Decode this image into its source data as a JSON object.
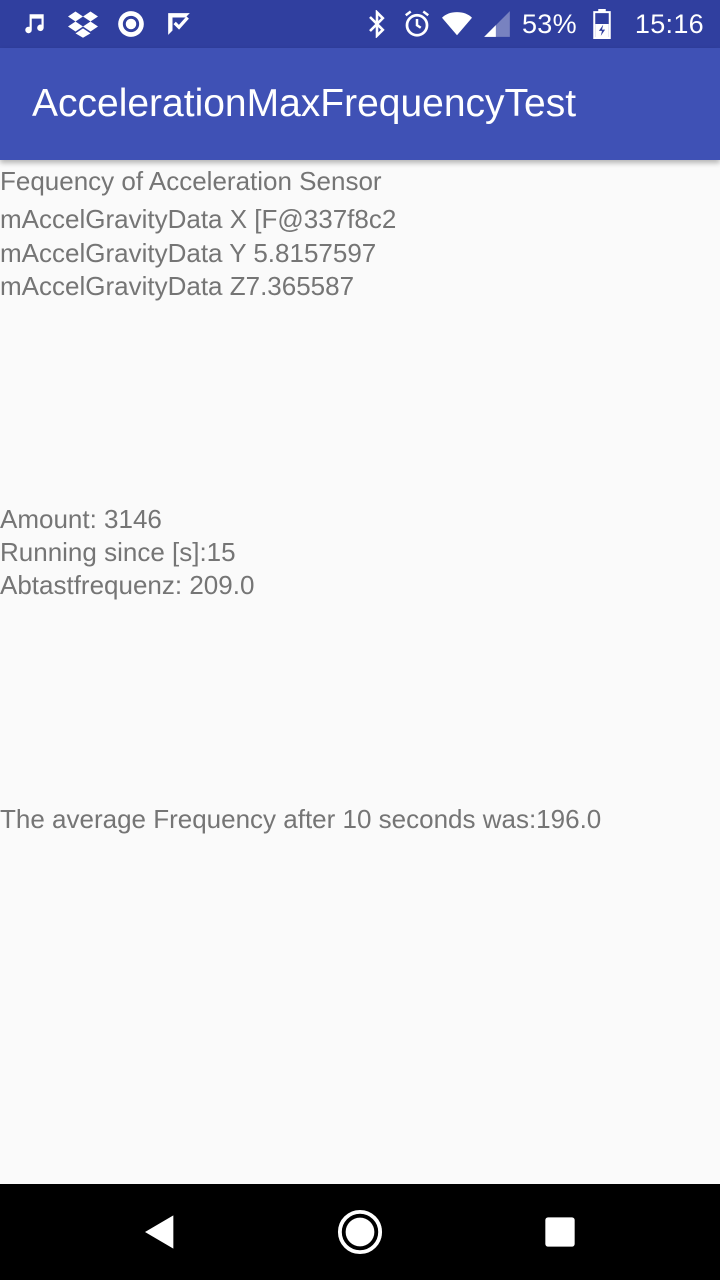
{
  "status_bar": {
    "icons_left": [
      "music-note-icon",
      "dropbox-icon",
      "record-circle-icon",
      "check-badge-icon"
    ],
    "icons_right": [
      "bluetooth-icon",
      "alarm-icon",
      "wifi-icon",
      "cell-signal-icon",
      "battery-icon"
    ],
    "battery_percent": "53%",
    "time": "15:16",
    "color": "#303f9f"
  },
  "app_bar": {
    "title": "AccelerationMaxFrequencyTest",
    "color": "#3f51b5"
  },
  "main": {
    "heading": "Fequency of Acceleration Sensor",
    "gravity_x": "mAccelGravityData X [F@337f8c2",
    "gravity_y": "mAccelGravityData Y 5.8157597",
    "gravity_z": "mAccelGravityData Z7.365587",
    "amount": "Amount: 3146",
    "running_since": "Running since [s]:15",
    "sampling_frequency": "Abtastfrequenz: 209.0",
    "average_frequency": "The average Frequency after 10 seconds was:196.0",
    "text_color": "#757575",
    "background": "#fafafa"
  },
  "nav_bar": {
    "buttons": [
      "back-icon",
      "home-icon",
      "recents-icon"
    ]
  }
}
